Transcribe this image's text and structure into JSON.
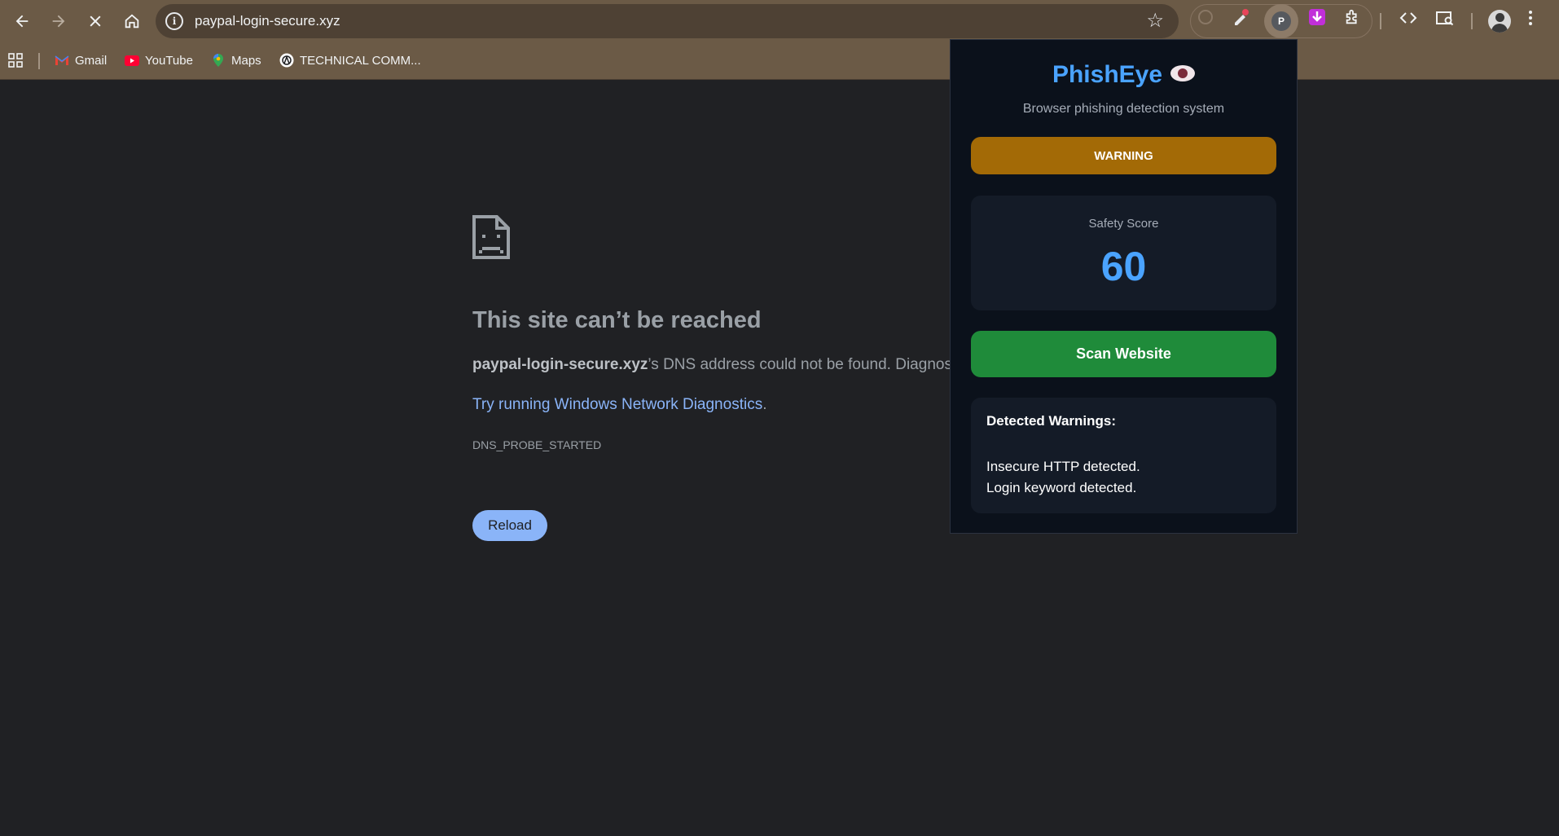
{
  "browser": {
    "url": "paypal-login-secure.xyz",
    "bookmarks": [
      {
        "label": "Gmail",
        "icon": "gmail-icon"
      },
      {
        "label": "YouTube",
        "icon": "youtube-icon"
      },
      {
        "label": "Maps",
        "icon": "maps-icon"
      },
      {
        "label": "TECHNICAL COMM...",
        "icon": "site-icon"
      }
    ],
    "extension_letter": "P"
  },
  "error_page": {
    "title": "This site can’t be reached",
    "domain": "paypal-login-secure.xyz",
    "description_suffix": "’s DNS address could not be found. Diagnosing the problem.",
    "diagnostics_link": "Try running Windows Network Diagnostics",
    "diagnostics_period": ".",
    "error_code": "DNS_PROBE_STARTED",
    "reload_label": "Reload"
  },
  "popup": {
    "title": "PhishEye",
    "subtitle": "Browser phishing detection system",
    "status": "WARNING",
    "status_color": "#a36a06",
    "score_label": "Safety Score",
    "score_value": "60",
    "scan_label": "Scan Website",
    "warnings_heading": "Detected Warnings:",
    "warnings": [
      "Insecure HTTP detected.",
      "Login keyword detected."
    ]
  }
}
